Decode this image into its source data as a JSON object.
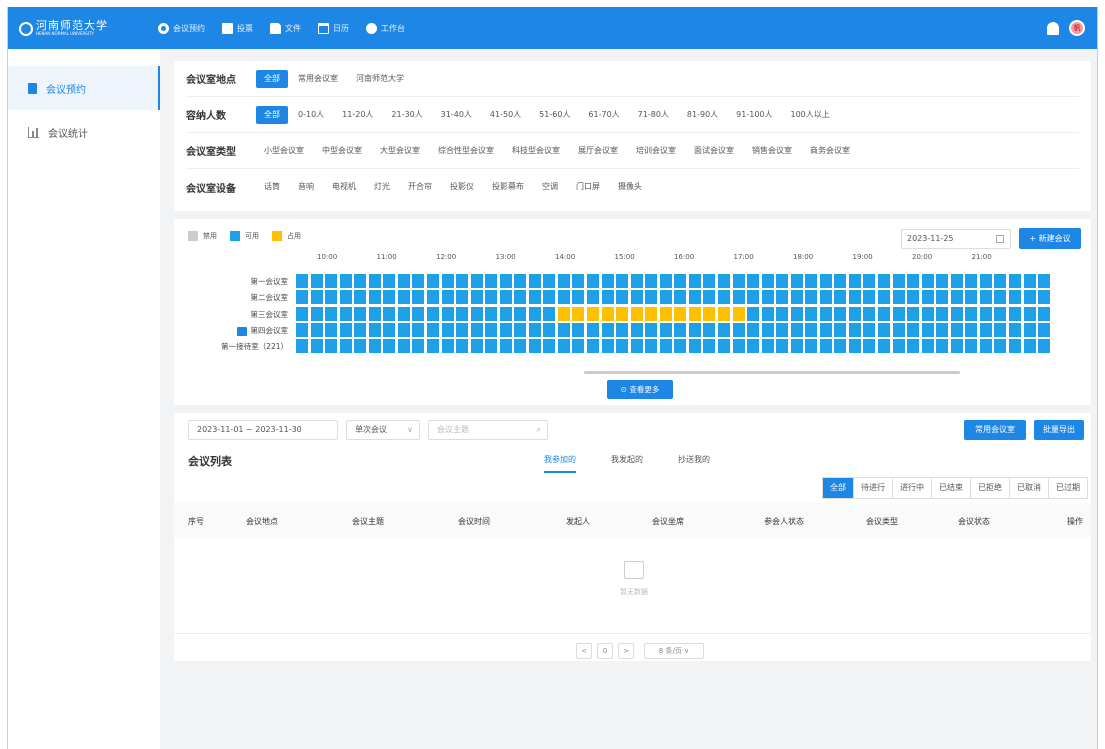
{
  "topbar": {
    "logo_name": "河南师范大学",
    "logo_sub": "HENAN NORMAL UNIVERSITY",
    "nav": [
      {
        "label": "会议预约",
        "icon": "clock-icon"
      },
      {
        "label": "投票",
        "icon": "vote-icon"
      },
      {
        "label": "文件",
        "icon": "folder-icon"
      },
      {
        "label": "日历",
        "icon": "calendar-icon"
      },
      {
        "label": "工作台",
        "icon": "gear-icon"
      }
    ],
    "avatar_text": "帆"
  },
  "sidebar": {
    "items": [
      {
        "label": "会议预约",
        "icon": "document-icon",
        "active": true
      },
      {
        "label": "会议统计",
        "icon": "bar-chart-icon",
        "active": false
      }
    ]
  },
  "filters": {
    "rows": [
      {
        "label": "会议室地点",
        "options": [
          "全部",
          "常用会议室",
          "河南师范大学"
        ],
        "selected": 0
      },
      {
        "label": "容纳人数",
        "options": [
          "全部",
          "0-10人",
          "11-20人",
          "21-30人",
          "31-40人",
          "41-50人",
          "51-60人",
          "61-70人",
          "71-80人",
          "81-90人",
          "91-100人",
          "100人以上"
        ],
        "selected": 0
      },
      {
        "label": "会议室类型",
        "options": [
          "小型会议室",
          "中型会议室",
          "大型会议室",
          "综合性型会议室",
          "科技型会议室",
          "展厅会议室",
          "培训会议室",
          "面试会议室",
          "销售会议室",
          "商务会议室"
        ],
        "selected": -1
      },
      {
        "label": "会议室设备",
        "options": [
          "话筒",
          "音响",
          "电视机",
          "灯光",
          "开合帘",
          "投影仪",
          "投影幕布",
          "空调",
          "门口屏",
          "摄像头"
        ],
        "selected": -1
      }
    ]
  },
  "schedule": {
    "legend": [
      {
        "label": "禁用",
        "color": "#cccccc"
      },
      {
        "label": "可用",
        "color": "#1e9fe8"
      },
      {
        "label": "占用",
        "color": "#ffc000"
      }
    ],
    "date": "2023-11-25",
    "new_button": "+ 新建会议",
    "hours": [
      "10:00",
      "11:00",
      "12:00",
      "13:00",
      "14:00",
      "15:00",
      "16:00",
      "17:00",
      "18:00",
      "19:00",
      "20:00",
      "21:00"
    ],
    "rooms": [
      {
        "name": "第一会议室",
        "busy": []
      },
      {
        "name": "第二会议室",
        "busy": []
      },
      {
        "name": "第三会议室",
        "busy": [
          18,
          19,
          20,
          21,
          22,
          23,
          24,
          25,
          26,
          27,
          28,
          29,
          30
        ]
      },
      {
        "name": "第四会议室",
        "busy": [],
        "has_image": true
      },
      {
        "name": "第一接待室（221）",
        "busy": []
      }
    ],
    "slot_count": 52,
    "more_button": "⊙ 查看更多"
  },
  "meeting_list": {
    "date_range": "2023-11-01  ~  2023-11-30",
    "meeting_type": "单次会议",
    "topic_placeholder": "会议主题",
    "btn_common": "常用会议室",
    "btn_export": "批量导出",
    "title": "会议列表",
    "tabs": [
      {
        "label": "我参加的",
        "active": true
      },
      {
        "label": "我发起的",
        "active": false
      },
      {
        "label": "抄送我的",
        "active": false
      }
    ],
    "status_filters": [
      "全部",
      "待进行",
      "进行中",
      "已结束",
      "已拒绝",
      "已取消",
      "已过期"
    ],
    "columns": [
      "序号",
      "会议地点",
      "会议主题",
      "会议时间",
      "发起人",
      "会议坐席",
      "参会人状态",
      "会议类型",
      "会议状态",
      "操作"
    ],
    "empty_text": "暂无数据",
    "pager": {
      "prev": "<",
      "page": "0",
      "next": ">",
      "page_size": "8 条/页 ∨"
    }
  }
}
